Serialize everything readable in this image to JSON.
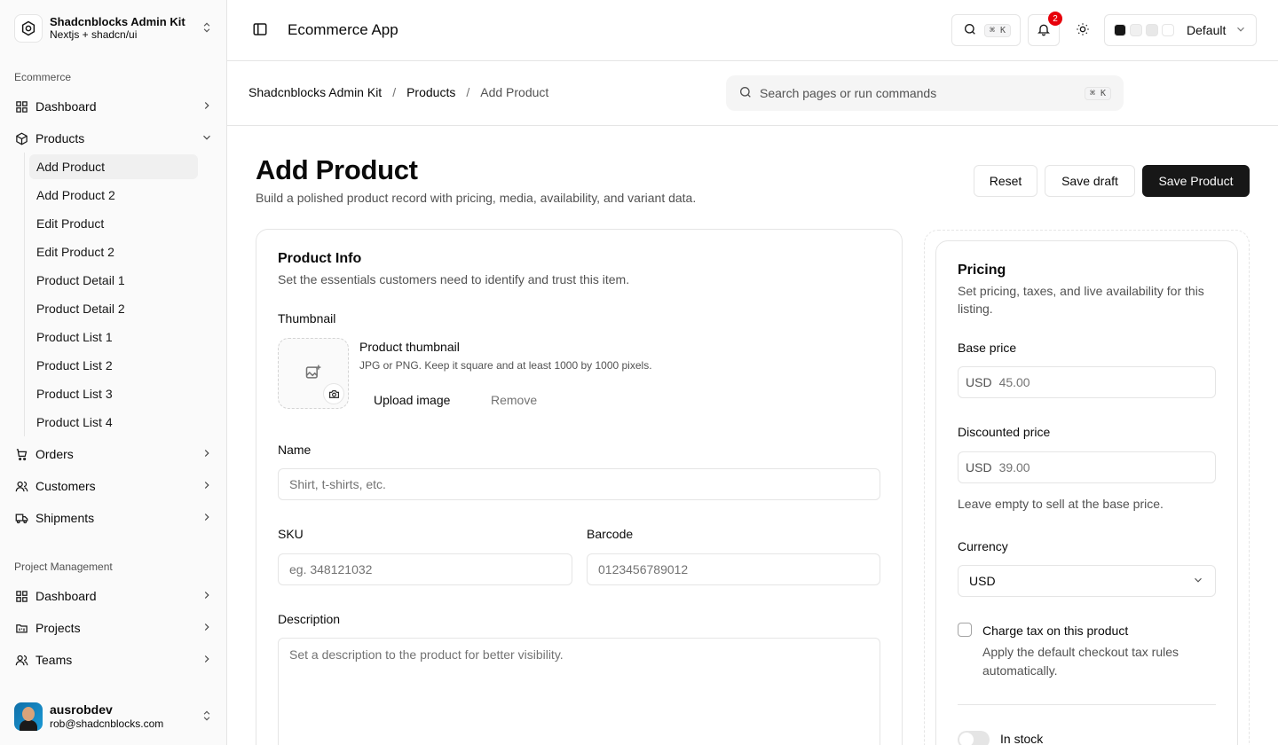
{
  "brand": {
    "title": "Shadcnblocks Admin Kit",
    "subtitle": "Nextjs + shadcn/ui"
  },
  "sidebar": {
    "group1": "Ecommerce",
    "items1": [
      {
        "label": "Dashboard"
      },
      {
        "label": "Products"
      }
    ],
    "sub_items": [
      {
        "label": "Add Product"
      },
      {
        "label": "Add Product 2"
      },
      {
        "label": "Edit Product"
      },
      {
        "label": "Edit Product 2"
      },
      {
        "label": "Product Detail 1"
      },
      {
        "label": "Product Detail 2"
      },
      {
        "label": "Product List 1"
      },
      {
        "label": "Product List 2"
      },
      {
        "label": "Product List 3"
      },
      {
        "label": "Product List 4"
      }
    ],
    "items1b": [
      {
        "label": "Orders"
      },
      {
        "label": "Customers"
      },
      {
        "label": "Shipments"
      }
    ],
    "group2": "Project Management",
    "items2": [
      {
        "label": "Dashboard"
      },
      {
        "label": "Projects"
      },
      {
        "label": "Teams"
      }
    ]
  },
  "user": {
    "name": "ausrobdev",
    "email": "rob@shadcnblocks.com"
  },
  "header": {
    "app_title": "Ecommerce App",
    "search_kbd": "⌘ K",
    "notification_count": "2",
    "theme_label": "Default",
    "theme_swatches": [
      "#171717",
      "#f0f0f0",
      "#e8e8e8",
      "#ffffff"
    ]
  },
  "breadcrumb": {
    "root": "Shadcnblocks Admin Kit",
    "section": "Products",
    "current": "Add Product",
    "sep": "/"
  },
  "command_search": {
    "placeholder": "Search pages or run commands",
    "kbd": "⌘ K"
  },
  "page": {
    "title": "Add Product",
    "description": "Build a polished product record with pricing, media, availability, and variant data.",
    "actions": {
      "reset": "Reset",
      "save_draft": "Save draft",
      "save": "Save Product"
    }
  },
  "product_info": {
    "title": "Product Info",
    "description": "Set the essentials customers need to identify and trust this item.",
    "thumbnail_label": "Thumbnail",
    "thumbnail_title": "Product thumbnail",
    "thumbnail_hint": "JPG or PNG. Keep it square and at least 1000 by 1000 pixels.",
    "upload_label": "Upload image",
    "remove_label": "Remove",
    "name_label": "Name",
    "name_placeholder": "Shirt, t-shirts, etc.",
    "sku_label": "SKU",
    "sku_placeholder": "eg. 348121032",
    "barcode_label": "Barcode",
    "barcode_placeholder": "0123456789012",
    "description_label": "Description",
    "description_placeholder": "Set a description to the product for better visibility."
  },
  "pricing": {
    "title": "Pricing",
    "description": "Set pricing, taxes, and live availability for this listing.",
    "base_label": "Base price",
    "currency_prefix": "USD",
    "base_value": "45.00",
    "discount_label": "Discounted price",
    "discount_value": "39.00",
    "discount_hint": "Leave empty to sell at the base price.",
    "currency_label": "Currency",
    "currency_value": "USD",
    "tax_label": "Charge tax on this product",
    "tax_hint": "Apply the default checkout tax rules automatically.",
    "stock_label": "In stock"
  }
}
